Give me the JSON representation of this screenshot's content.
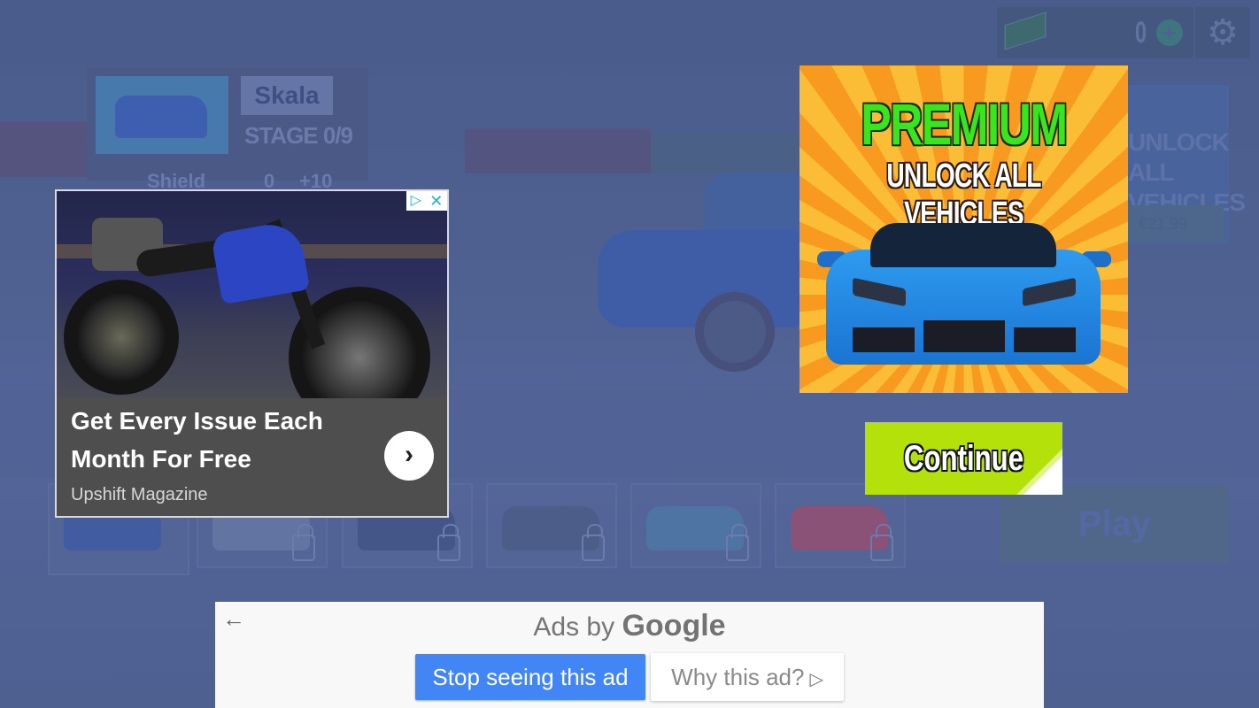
{
  "game": {
    "currency": {
      "value": "0",
      "icon": "cash-icon",
      "add_icon": "plus-circle-icon"
    },
    "settings_icon": "gear-icon",
    "vehicle": {
      "name": "Skala",
      "stage": "STAGE 0/9"
    },
    "upgrade_row": {
      "label": "Shield",
      "value": "0",
      "delta": "+10"
    },
    "unlock_panel": {
      "text_line1": "UNLOCK ALL",
      "text_line2": "VEHICLES",
      "price": "€21.99"
    },
    "vehicle_slots": [
      {
        "color": "#3c58a6",
        "locked": false
      },
      {
        "color": "#6a7aa6",
        "locked": true
      },
      {
        "color": "#3f4f80",
        "locked": true
      },
      {
        "color": "#4a5a85",
        "locked": true
      },
      {
        "color": "#4c7aa8",
        "locked": true
      },
      {
        "color": "#a34a6a",
        "locked": true
      }
    ],
    "play_label": "Play"
  },
  "native_ad": {
    "headline": "Get Every Issue Each Month For Free",
    "advertiser": "Upshift Magazine",
    "adchoices_icon": "▷",
    "close_icon": "✕",
    "cta_icon": "›"
  },
  "premium_ad": {
    "title": "PREMIUM",
    "subtitle": "UNLOCK ALL VEHICLES",
    "continue_label": "Continue",
    "colors": {
      "title": "#38e51e",
      "continue_bg": "#b4e10a"
    }
  },
  "ads_bar": {
    "back_icon": "←",
    "ads_by": "Ads by",
    "brand": "Google",
    "stop_label": "Stop seeing this ad",
    "why_label": "Why this ad?",
    "why_icon": "▷",
    "colors": {
      "stop_bg": "#4285f4"
    }
  }
}
